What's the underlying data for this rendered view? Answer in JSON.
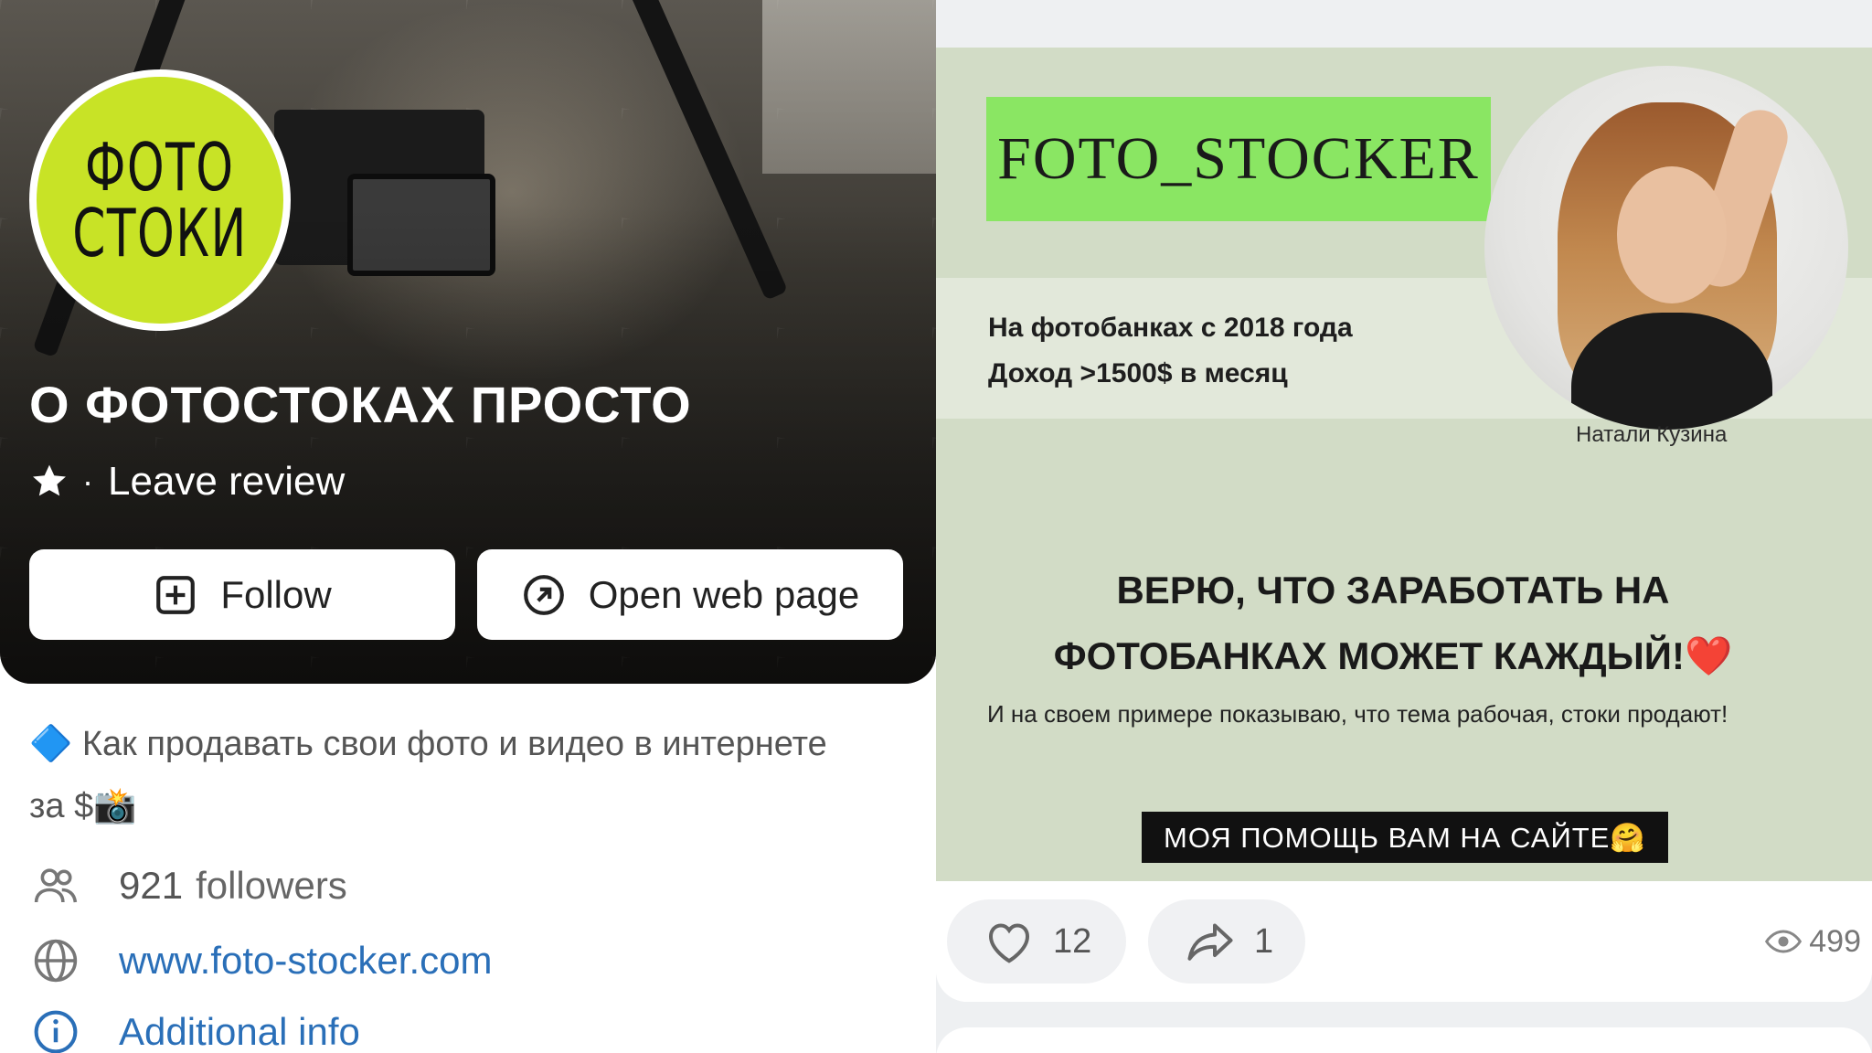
{
  "channel": {
    "logo_line1": "ФОТО",
    "logo_line2": "СТОКИ",
    "title": "О ФОТОСТОКАХ ПРОСТО",
    "review_separator": "·",
    "review_label": "Leave review",
    "follow_label": "Follow",
    "open_web_label": "Open web page",
    "description_line1": "🔷 Как продавать свои фото и видео в интернете",
    "description_line2": "за $📸",
    "followers_count": "921",
    "followers_label": "followers",
    "website": "www.foto-stocker.com",
    "additional_info": "Additional info"
  },
  "post": {
    "top_text": "",
    "tag": "FOTO_STOCKER",
    "line1": "На фотобанках с 2018 года",
    "line2": "Доход >1500$ в месяц",
    "caption": "Натали Кузина",
    "headline1": "ВЕРЮ, ЧТО ЗАРАБОТАТЬ НА",
    "headline2": "ФОТОБАНКАХ МОЖЕТ КАЖДЫЙ!",
    "heart": "❤️",
    "subline": "И на своем примере показываю, что тема рабочая, стоки продают!",
    "bar_text": "МОЯ ПОМОЩЬ ВАМ НА САЙТЕ🤗",
    "likes": "12",
    "shares": "1",
    "views": "499"
  },
  "colors": {
    "logo_bg": "#c8e326",
    "tag_bg": "#8ae663",
    "promo_bg": "#d2dcc6",
    "link": "#2a6fb8"
  },
  "icons": [
    "star-icon",
    "plus-square-icon",
    "arrow-circle-icon",
    "followers-icon",
    "globe-icon",
    "info-icon",
    "heart-icon",
    "share-icon",
    "eye-icon"
  ]
}
